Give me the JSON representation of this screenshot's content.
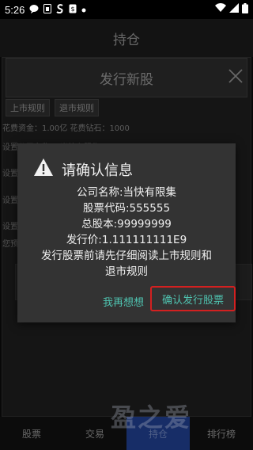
{
  "status_bar": {
    "time": "5:26"
  },
  "app_bar": {
    "title": "持仓"
  },
  "panel": {
    "title": "发行新股",
    "rule_buttons": [
      "上市规则",
      "退市规则"
    ],
    "fee_text": "花费资金：1.00亿 花费钻石：1000",
    "faded_rows": [
      "设置公司名称：  当快有限集",
      "设置",
      "设置",
      "设置",
      "您预"
    ]
  },
  "dialog": {
    "title": "请确认信息",
    "lines": [
      "公司名称:当快有限集",
      "股票代码:555555",
      "总股本:99999999",
      "发行价:1.111111111E9",
      "发行股票前请先仔细阅读上市规则和",
      "退市规则"
    ],
    "cancel_label": "我再想想",
    "confirm_label": "确认发行股票"
  },
  "tabs": [
    "股票",
    "交易",
    "持仓",
    "排行榜"
  ],
  "active_tab": 2,
  "watermark": "盈之爱",
  "colors": {
    "accent": "#4fc3b0",
    "highlight_border": "#d32020",
    "active_tab": "#1f3d8a"
  }
}
